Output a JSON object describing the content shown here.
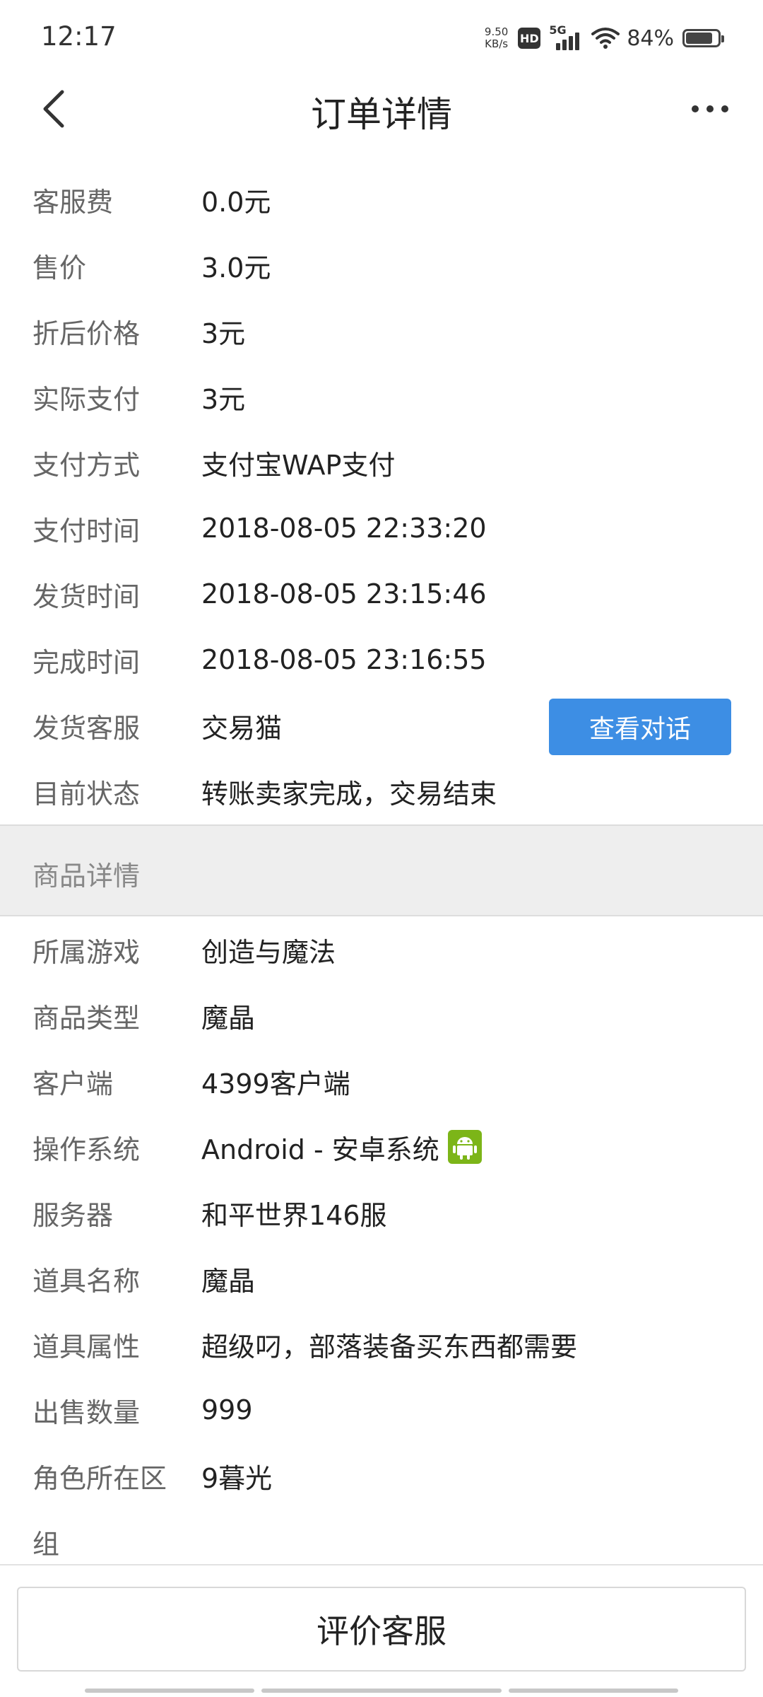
{
  "status_bar": {
    "time": "12:17",
    "net_speed_value": "9.50",
    "net_speed_unit": "KB/s",
    "hd": "HD",
    "network": "5G",
    "battery_percent": "84%",
    "battery_level": 0.84
  },
  "nav": {
    "title": "订单详情",
    "back_icon": "chevron-left-icon",
    "more_icon": "more-horizontal-icon"
  },
  "order_rows": [
    {
      "label": "客服费",
      "value": "0.0元"
    },
    {
      "label": "售价",
      "value": "3.0元"
    },
    {
      "label": "折后价格",
      "value": "3元"
    },
    {
      "label": "实际支付",
      "value": "3元"
    },
    {
      "label": "支付方式",
      "value": "支付宝WAP支付"
    },
    {
      "label": "支付时间",
      "value": "2018-08-05 22:33:20"
    },
    {
      "label": "发货时间",
      "value": "2018-08-05 23:15:46"
    },
    {
      "label": "完成时间",
      "value": "2018-08-05 23:16:55"
    },
    {
      "label": "发货客服",
      "value": "交易猫"
    },
    {
      "label": "目前状态",
      "value": "转账卖家完成，交易结束"
    }
  ],
  "view_chat_label": "查看对话",
  "section_title": "商品详情",
  "goods_rows": [
    {
      "label": "所属游戏",
      "value": "创造与魔法"
    },
    {
      "label": "商品类型",
      "value": "魔晶"
    },
    {
      "label": "客户端",
      "value": "4399客户端"
    },
    {
      "label": "操作系统",
      "value": "Android - 安卓系统"
    },
    {
      "label": "服务器",
      "value": "和平世界146服"
    },
    {
      "label": "道具名称",
      "value": "魔晶"
    },
    {
      "label": "道具属性",
      "value": "超级叼，部落装备买东西都需要"
    },
    {
      "label": "出售数量",
      "value": "999"
    },
    {
      "label": "角色所在区",
      "value": "9暮光"
    },
    {
      "label": "组",
      "value": ""
    }
  ],
  "rate_button_label": "评价客服",
  "colors": {
    "accent": "#3d8ee4",
    "android_green": "#7cb518",
    "label_gray": "#666666",
    "section_bg": "#eeeeee"
  }
}
